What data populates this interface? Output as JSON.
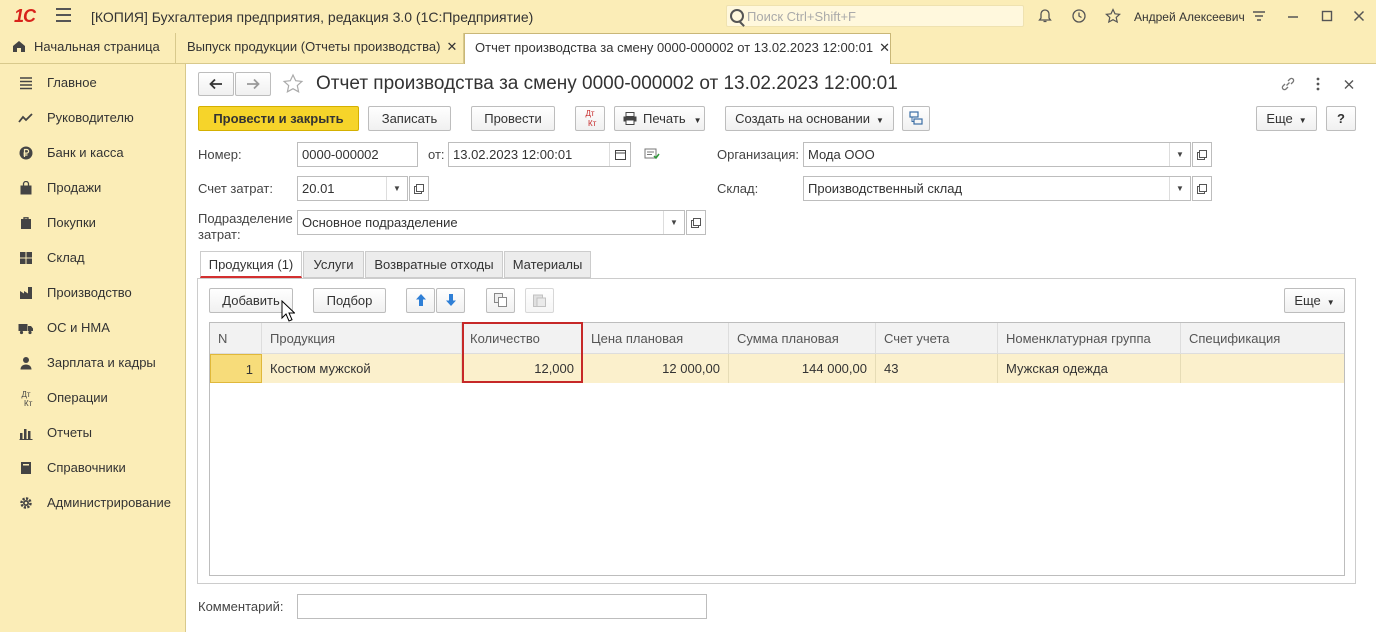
{
  "app": {
    "logo": "1С",
    "title": "[КОПИЯ] Бухгалтерия предприятия, редакция 3.0  (1С:Предприятие)",
    "search_placeholder": "Поиск Ctrl+Shift+F",
    "user": "Андрей Алексеевич"
  },
  "tabs": [
    {
      "label": "Начальная страница"
    },
    {
      "label": "Выпуск продукции (Отчеты производства)",
      "close": "✕"
    },
    {
      "label": "Отчет производства за смену 0000-000002 от 13.02.2023 12:00:01",
      "close": "✕"
    }
  ],
  "sidebar": {
    "items": [
      {
        "label": "Главное",
        "icon": "list-icon"
      },
      {
        "label": "Руководителю",
        "icon": "trend-icon"
      },
      {
        "label": "Банк и касса",
        "icon": "ruble-icon"
      },
      {
        "label": "Продажи",
        "icon": "bag-icon"
      },
      {
        "label": "Покупки",
        "icon": "cart-icon"
      },
      {
        "label": "Склад",
        "icon": "grid-icon"
      },
      {
        "label": "Производство",
        "icon": "factory-icon"
      },
      {
        "label": "ОС и НМА",
        "icon": "truck-icon"
      },
      {
        "label": "Зарплата и кадры",
        "icon": "person-icon"
      },
      {
        "label": "Операции",
        "icon": "dtkt-icon"
      },
      {
        "label": "Отчеты",
        "icon": "bars-icon"
      },
      {
        "label": "Справочники",
        "icon": "book-icon"
      },
      {
        "label": "Администрирование",
        "icon": "gear-icon"
      }
    ]
  },
  "form": {
    "title": "Отчет производства за смену 0000-000002 от 13.02.2023 12:00:01",
    "toolbar": {
      "post_close": "Провести и закрыть",
      "save": "Записать",
      "post": "Провести",
      "dtkt": "Дт Кт",
      "print": "Печать",
      "create_based": "Создать на основании",
      "more": "Еще",
      "help": "?"
    },
    "fields": {
      "number_label": "Номер:",
      "number": "0000-000002",
      "date_label": "от:",
      "date": "13.02.2023 12:00:01",
      "org_label": "Организация:",
      "org": "Мода ООО",
      "account_label": "Счет затрат:",
      "account": "20.01",
      "warehouse_label": "Склад:",
      "warehouse": "Производственный склад",
      "dept_label_1": "Подразделение",
      "dept_label_2": "затрат:",
      "dept": "Основное подразделение",
      "comment_label": "Комментарий:",
      "comment": ""
    },
    "subtabs": [
      {
        "label": "Продукция (1)"
      },
      {
        "label": "Услуги"
      },
      {
        "label": "Возвратные отходы"
      },
      {
        "label": "Материалы"
      }
    ],
    "table_toolbar": {
      "add": "Добавить",
      "pick": "Подбор",
      "more": "Еще"
    },
    "table": {
      "columns": [
        "N",
        "Продукция",
        "Количество",
        "Цена плановая",
        "Сумма плановая",
        "Счет учета",
        "Номенклатурная группа",
        "Спецификация"
      ],
      "rows": [
        [
          "1",
          "Костюм мужской",
          "12,000",
          "12 000,00",
          "144 000,00",
          "43",
          "Мужская одежда",
          ""
        ]
      ]
    }
  },
  "colors": {
    "chrome": "#fbedb7",
    "primary_button": "#f6d42a",
    "selected_row": "#fbf0cc",
    "highlight_border": "#c62828"
  }
}
